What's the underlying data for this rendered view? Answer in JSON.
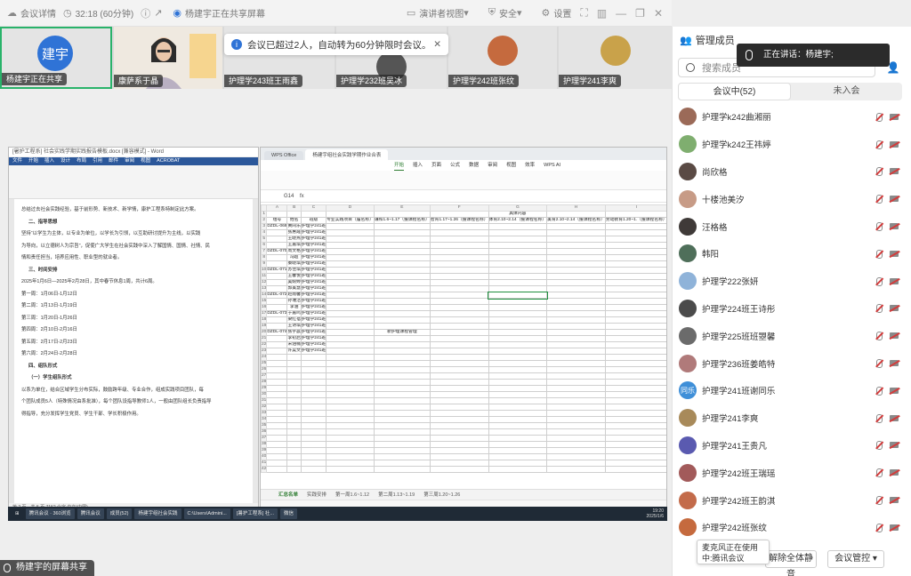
{
  "topbar": {
    "meeting_details": "会议详情",
    "timer": "32:18 (60分钟)",
    "sharing_status": "杨建宇正在共享屏幕",
    "speaker_view": "演讲者视图",
    "security": "安全",
    "settings": "设置"
  },
  "participants": [
    {
      "name": "杨建宇正在共享",
      "avatar_text": "建宇",
      "color": "#2f73d6"
    },
    {
      "name": "康萨系于晶",
      "avatar_text": "",
      "color": "#b38a5e"
    },
    {
      "name": "护理学243班王雨鑫",
      "avatar_text": "",
      "color": "#888"
    },
    {
      "name": "护理学232班吴冰",
      "avatar_text": "",
      "color": "#777"
    },
    {
      "name": "护理学242班张纹",
      "avatar_text": "",
      "color": "#c56a3e"
    },
    {
      "name": "护理学241李爽",
      "avatar_text": "",
      "color": "#c9a24a"
    }
  ],
  "toast": {
    "text": "会议已超过2人，自动转为60分钟限时会议。"
  },
  "word": {
    "title": "[暑护工程系] 社会实践学期实践报告模板.docx [兼容模式] - Word",
    "menus": [
      "文件",
      "开始",
      "插入",
      "设计",
      "布局",
      "引用",
      "邮件",
      "审阅",
      "视图",
      "ACROBAT"
    ],
    "lines": [
      {
        "t": "总结过去社会实践经验，基于前形势、新技术、新学情，康护工程系特制定此方案。",
        "h": false
      },
      {
        "t": "二、指导思想",
        "h": true
      },
      {
        "t": "坚持“以学生为主体，以专业为单位，以学长为引领，以互助研讨提升为主线，以实践",
        "h": false
      },
      {
        "t": "为导向，以立德树人为宗旨”，促使广大学生在社会实践中深入了解国情、国情、社情、民",
        "h": false
      },
      {
        "t": "情和责任担当，培养应用性、职业型的就业者。",
        "h": false
      },
      {
        "t": "三、时间安排",
        "h": true
      },
      {
        "t": "2025年1月6日—2025年2月28日，其中春节休息1周，共计6周。",
        "h": false
      },
      {
        "t": "第一周：1月06日-1月12日",
        "h": false
      },
      {
        "t": "第二周：1月13日-1月19日",
        "h": false
      },
      {
        "t": "第三周：1月20日-1月26日",
        "h": false
      },
      {
        "t": "第四周：2月10日-2月16日",
        "h": false
      },
      {
        "t": "第五周：2月17日-2月23日",
        "h": false
      },
      {
        "t": "第六周：2月24日-2月28日",
        "h": false
      },
      {
        "t": "四、组队形式",
        "h": true
      },
      {
        "t": "（一）学生组队形式",
        "h": true
      },
      {
        "t": "以系为单位，结合区域学生分布实际，鼓励跨年级、专业合作，组成实践项目团队，每",
        "h": false
      },
      {
        "t": "个团队成员5人（特殊情况由系批准），每个团队设指导教师1人，一般由团队组长负责指导",
        "h": false
      },
      {
        "t": "得指导，充分发挥学生党员、学生干部、学长积极作用。",
        "h": false
      }
    ],
    "status": "第 2 页，共 5 页    7152 个字    中文(中国)"
  },
  "wps": {
    "tabs": [
      "WPS Office",
      "杨建宇组社会实践学期作业合表"
    ],
    "menus": [
      "开始",
      "插入",
      "页面",
      "公式",
      "数据",
      "审阅",
      "视图",
      "效率",
      "WPS AI"
    ],
    "cell_ref": "G14",
    "col_headers": [
      "",
      "A",
      "B",
      "C",
      "D",
      "E",
      "F",
      "G",
      "H",
      "I"
    ],
    "header_row2": [
      "组号",
      "姓名",
      "班级",
      "专业实践项目（履名称）",
      "谦和1.6~1.17（援课程名称）",
      "智育1.17~1.26（援课程名称）",
      "体育2.10~2.14（援课程名称）",
      "美育2.10~2.14（援课程名称）",
      "劳动教育1.20~1.（援课程名称）"
    ],
    "banner": "具体内容",
    "groups": [
      "DZDL-069",
      "DZDL-070",
      "DZDL-071",
      "DZDL-072",
      "DZDL-073",
      "DZDL-074"
    ],
    "names": [
      "黄同乐",
      "张惠霞",
      "王晓燕",
      "王嘉琪",
      "周文格",
      "冯超",
      "秦晓琪",
      "苏佳琪",
      "王馨悦",
      "吴婉婷",
      "郭美慧",
      "赵雨馨",
      "孙瑞洁",
      "李涵",
      "于嘉鸣",
      "梁红蓓",
      "王诗琪",
      "张宇晨",
      "李初启",
      "宋涵楠",
      "许昊文"
    ],
    "class_cell": "护理学241班",
    "special_cell": "新护理课程管理",
    "sheets": [
      "汇总名单",
      "实践安排",
      "第一周1.6~1.12",
      "第二周1.13~1.19",
      "第三周1.20~1.26"
    ]
  },
  "taskbar": {
    "items": [
      "腾讯会议 · 360浏览",
      "腾讯会议",
      "成员(52)",
      "杨建宇组社会实践",
      "C:\\Users\\Admini...",
      "[暑护工程系] 社...",
      "微信"
    ],
    "time": "19:20",
    "date": "2025/1/6"
  },
  "share_label": "杨建宇的屏幕共享",
  "panel": {
    "title": "管理成员",
    "speaking": "正在讲话：杨建宇;",
    "search_placeholder": "搜索成员",
    "tab_in": "会议中(52)",
    "tab_out": "未入会",
    "members": [
      {
        "name": "护理学k242曲湘丽",
        "color": "#9b6a58",
        "text": ""
      },
      {
        "name": "护理学k242王祎婷",
        "color": "#7fae6f",
        "text": ""
      },
      {
        "name": "尚欣格",
        "color": "#5a4a44",
        "text": ""
      },
      {
        "name": "十楼池美汐",
        "color": "#c79b86",
        "text": ""
      },
      {
        "name": "汪格格",
        "color": "#3f3a38",
        "text": ""
      },
      {
        "name": "韩阳",
        "color": "#4f6f5a",
        "text": ""
      },
      {
        "name": "护理学222张妍",
        "color": "#8fb3d9",
        "text": ""
      },
      {
        "name": "护理学224班王诗彤",
        "color": "#4b4b4b",
        "text": ""
      },
      {
        "name": "护理学225班班曌馨",
        "color": "#6b6b6b",
        "text": ""
      },
      {
        "name": "护理学236班姜皓特",
        "color": "#b07a7a",
        "text": ""
      },
      {
        "name": "护理学241班谢同乐",
        "color": "#3f8fd8",
        "text": "同乐"
      },
      {
        "name": "护理学241李爽",
        "color": "#a88a5a",
        "text": ""
      },
      {
        "name": "护理学241王贵凡",
        "color": "#5a5ab0",
        "text": ""
      },
      {
        "name": "护理学242班王瑞瑶",
        "color": "#a25a5a",
        "text": ""
      },
      {
        "name": "护理学242班王韵淇",
        "color": "#c36b4a",
        "text": ""
      },
      {
        "name": "护理学242班张纹",
        "color": "#c56a3e",
        "text": ""
      }
    ],
    "mic_tip": "麦克风正在使用中:腾讯会议",
    "unmute_all": "解除全体静音",
    "meeting_control": "会议管控"
  }
}
